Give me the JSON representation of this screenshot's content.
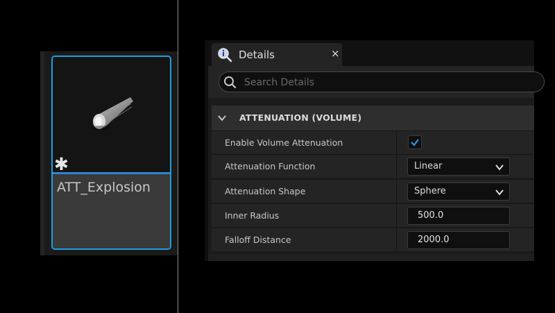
{
  "asset": {
    "name": "ATT_Explosion",
    "modified_marker": "✱"
  },
  "details": {
    "tab_title": "Details",
    "close_glyph": "×",
    "search": {
      "placeholder": "Search Details",
      "value": ""
    },
    "category": {
      "title": "ATTENUATION (VOLUME)",
      "expanded": true
    },
    "properties": {
      "enable_volume_attenuation": {
        "label": "Enable Volume Attenuation",
        "checked": true
      },
      "attenuation_function": {
        "label": "Attenuation Function",
        "value": "Linear"
      },
      "attenuation_shape": {
        "label": "Attenuation Shape",
        "value": "Sphere"
      },
      "inner_radius": {
        "label": "Inner Radius",
        "value": "500.0"
      },
      "falloff_distance": {
        "label": "Falloff Distance",
        "value": "2000.0"
      }
    }
  },
  "colors": {
    "selection_accent": "#1e9fe0",
    "checkbox_check": "#2a9ae8",
    "panel_bg": "#242424"
  }
}
